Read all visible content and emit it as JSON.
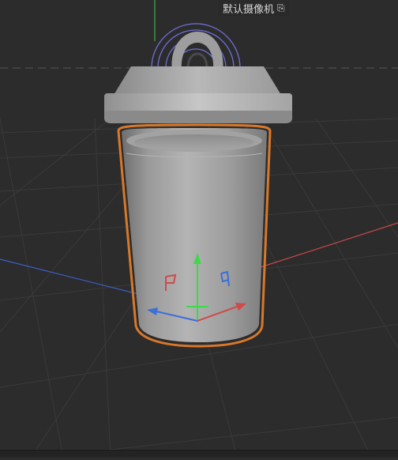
{
  "viewport": {
    "camera_name": "默认摄像机",
    "camera_lock_icon": "camera-lock-icon",
    "object": "trash-can",
    "gizmo_icons": [
      "move-gizmo-icon",
      "axis-x-icon",
      "axis-y-icon",
      "axis-z-icon"
    ],
    "colors": {
      "background": "#2c2c2c",
      "selection_outline": "#d8782a",
      "axis_x": "#d04a4a",
      "axis_y": "#3fd84a",
      "axis_z": "#3c6fd8",
      "rotation_handle": "#6f6fd8"
    }
  }
}
